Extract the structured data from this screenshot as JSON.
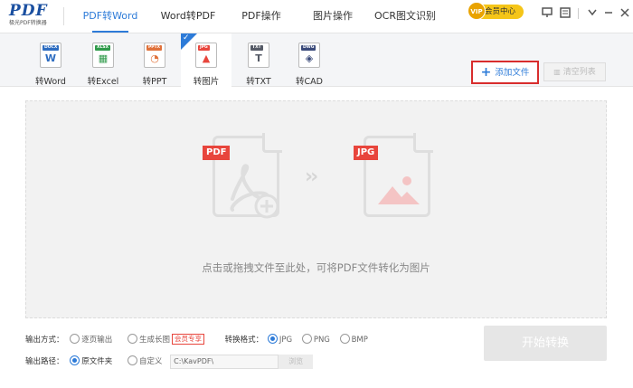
{
  "app": {
    "logo_text": "PDF",
    "logo_subtitle": "极光PDF转换器"
  },
  "nav": {
    "tabs": [
      {
        "label": "PDF转Word",
        "active": true
      },
      {
        "label": "Word转PDF",
        "active": false
      },
      {
        "label": "PDF操作",
        "active": false
      },
      {
        "label": "图片操作",
        "active": false
      },
      {
        "label": "OCR图文识别",
        "active": false
      }
    ],
    "vip_label": "会员中心",
    "vip_badge": "VIP"
  },
  "tools": [
    {
      "label": "转Word",
      "tag": "DOCX",
      "color": "#2d6cc0",
      "icon": "word-doc-icon",
      "glyph": "W",
      "active": false
    },
    {
      "label": "转Excel",
      "tag": "XLSX",
      "color": "#2f9a4a",
      "icon": "excel-doc-icon",
      "glyph": "▦",
      "active": false
    },
    {
      "label": "转PPT",
      "tag": "PPTX",
      "color": "#e0713a",
      "icon": "ppt-doc-icon",
      "glyph": "◔",
      "active": false
    },
    {
      "label": "转图片",
      "tag": "JPG",
      "color": "#e8453c",
      "icon": "image-doc-icon",
      "glyph": "▲",
      "active": true
    },
    {
      "label": "转TXT",
      "tag": "TXT",
      "color": "#555a66",
      "icon": "txt-doc-icon",
      "glyph": "T",
      "active": false
    },
    {
      "label": "转CAD",
      "tag": "DWG",
      "color": "#3a4a7a",
      "icon": "cad-doc-icon",
      "glyph": "◈",
      "active": false
    }
  ],
  "actions": {
    "add_file": "添加文件",
    "clear_list": "清空列表"
  },
  "droparea": {
    "source_label": "PDF",
    "target_label": "JPG",
    "hint": "点击或拖拽文件至此处，可将PDF文件转化为图片"
  },
  "settings": {
    "output_mode_label": "输出方式：",
    "output_mode_options": [
      "逐页输出",
      "生成长图"
    ],
    "output_mode_selected": 0,
    "vip_tag": "会员专享",
    "format_label": "转换格式：",
    "format_options": [
      "JPG",
      "PNG",
      "BMP"
    ],
    "format_selected": 0,
    "path_label": "输出路径：",
    "path_options": [
      "原文件夹",
      "自定义"
    ],
    "path_selected": 0,
    "path_value": "C:\\KavPDF\\",
    "browse_label": "浏览"
  },
  "start_button": "开始转换",
  "colors": {
    "accent": "#2d7bd8",
    "highlight_border": "#d82d2d",
    "label_red": "#e8453c"
  }
}
